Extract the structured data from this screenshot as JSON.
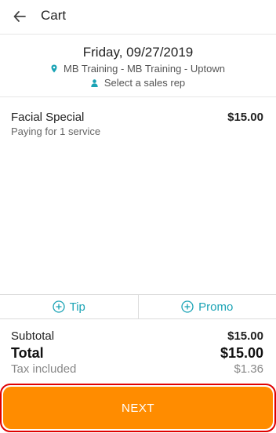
{
  "topbar": {
    "title": "Cart"
  },
  "appointment": {
    "date": "Friday, 09/27/2019",
    "location": "MB Training - MB Training - Uptown",
    "sales_rep": "Select a sales rep"
  },
  "items": [
    {
      "name": "Facial Special",
      "subtitle": "Paying for 1 service",
      "price": "$15.00"
    }
  ],
  "actions": {
    "tip": "Tip",
    "promo": "Promo"
  },
  "totals": {
    "subtotal_label": "Subtotal",
    "subtotal": "$15.00",
    "total_label": "Total",
    "total": "$15.00",
    "tax_label": "Tax included",
    "tax": "$1.36"
  },
  "footer": {
    "next_label": "NEXT"
  },
  "colors": {
    "accent": "#1aa3b5",
    "primary_button": "#ff8c00",
    "highlight": "#e00000"
  }
}
